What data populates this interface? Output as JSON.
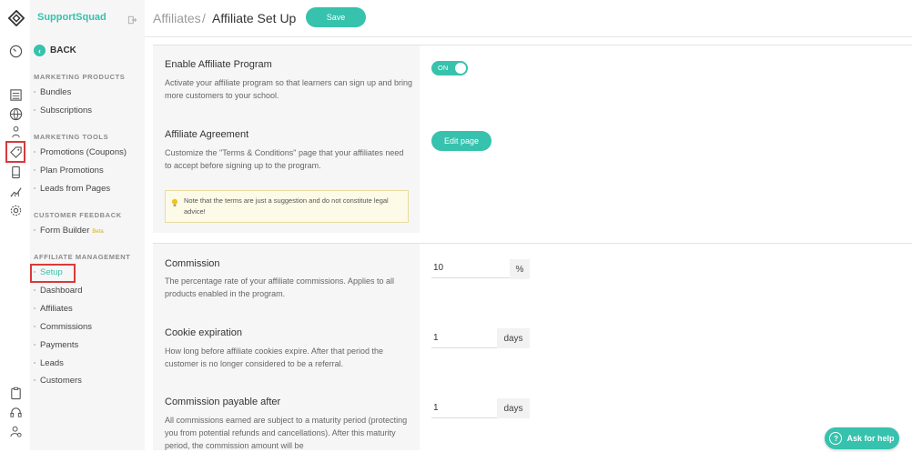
{
  "brand": {
    "name": "SupportSquad"
  },
  "header": {
    "crumb_parent": "Affiliates",
    "crumb_separator": "/",
    "crumb_current": "Affiliate Set Up",
    "save_label": "Save"
  },
  "sidebar": {
    "back_label": "BACK",
    "sections": [
      {
        "title": "MARKETING PRODUCTS",
        "items": [
          "Bundles",
          "Subscriptions"
        ]
      },
      {
        "title": "MARKETING TOOLS",
        "items": [
          "Promotions (Coupons)",
          "Plan Promotions",
          "Leads from Pages"
        ]
      },
      {
        "title": "CUSTOMER FEEDBACK",
        "items": [
          "Form Builder"
        ],
        "badge": "Beta"
      },
      {
        "title": "AFFILIATE MANAGEMENT",
        "items": [
          "Setup",
          "Dashboard",
          "Affiliates",
          "Commissions",
          "Payments",
          "Leads",
          "Customers"
        ]
      }
    ],
    "active_item": "Setup"
  },
  "rail_icons": [
    "dashboard-icon",
    "list-icon",
    "globe-icon",
    "users-icon",
    "tag-icon",
    "mobile-icon",
    "analytics-icon",
    "settings-icon",
    "clipboard-icon",
    "support-icon",
    "user-settings-icon"
  ],
  "settings": {
    "enable": {
      "title": "Enable Affiliate Program",
      "desc": "Activate your affiliate program so that learners can sign up and bring more customers to your school.",
      "toggle_label": "ON"
    },
    "agreement": {
      "title": "Affiliate Agreement",
      "desc": "Customize the \"Terms & Conditions\" page that your affiliates need to accept before signing up to the program.",
      "button_label": "Edit page",
      "note": "Note that the terms are just a suggestion and do not constitute legal advice!"
    },
    "commission": {
      "title": "Commission",
      "desc": "The percentage rate of your affiliate commissions. Applies to all products enabled in the program.",
      "value": "10",
      "unit": "%"
    },
    "cookie": {
      "title": "Cookie expiration",
      "desc": "How long before affiliate cookies expire. After that period the customer is no longer considered to be a referral.",
      "value": "1",
      "unit": "days"
    },
    "payable": {
      "title": "Commission payable after",
      "desc": "All commissions earned are subject to a maturity period (protecting you from potential refunds and cancellations). After this maturity period, the commission amount will be",
      "value": "1",
      "unit": "days"
    }
  },
  "help": {
    "label": "Ask for help"
  },
  "colors": {
    "accent": "#36c2ad",
    "highlight": "#d93a3a"
  }
}
